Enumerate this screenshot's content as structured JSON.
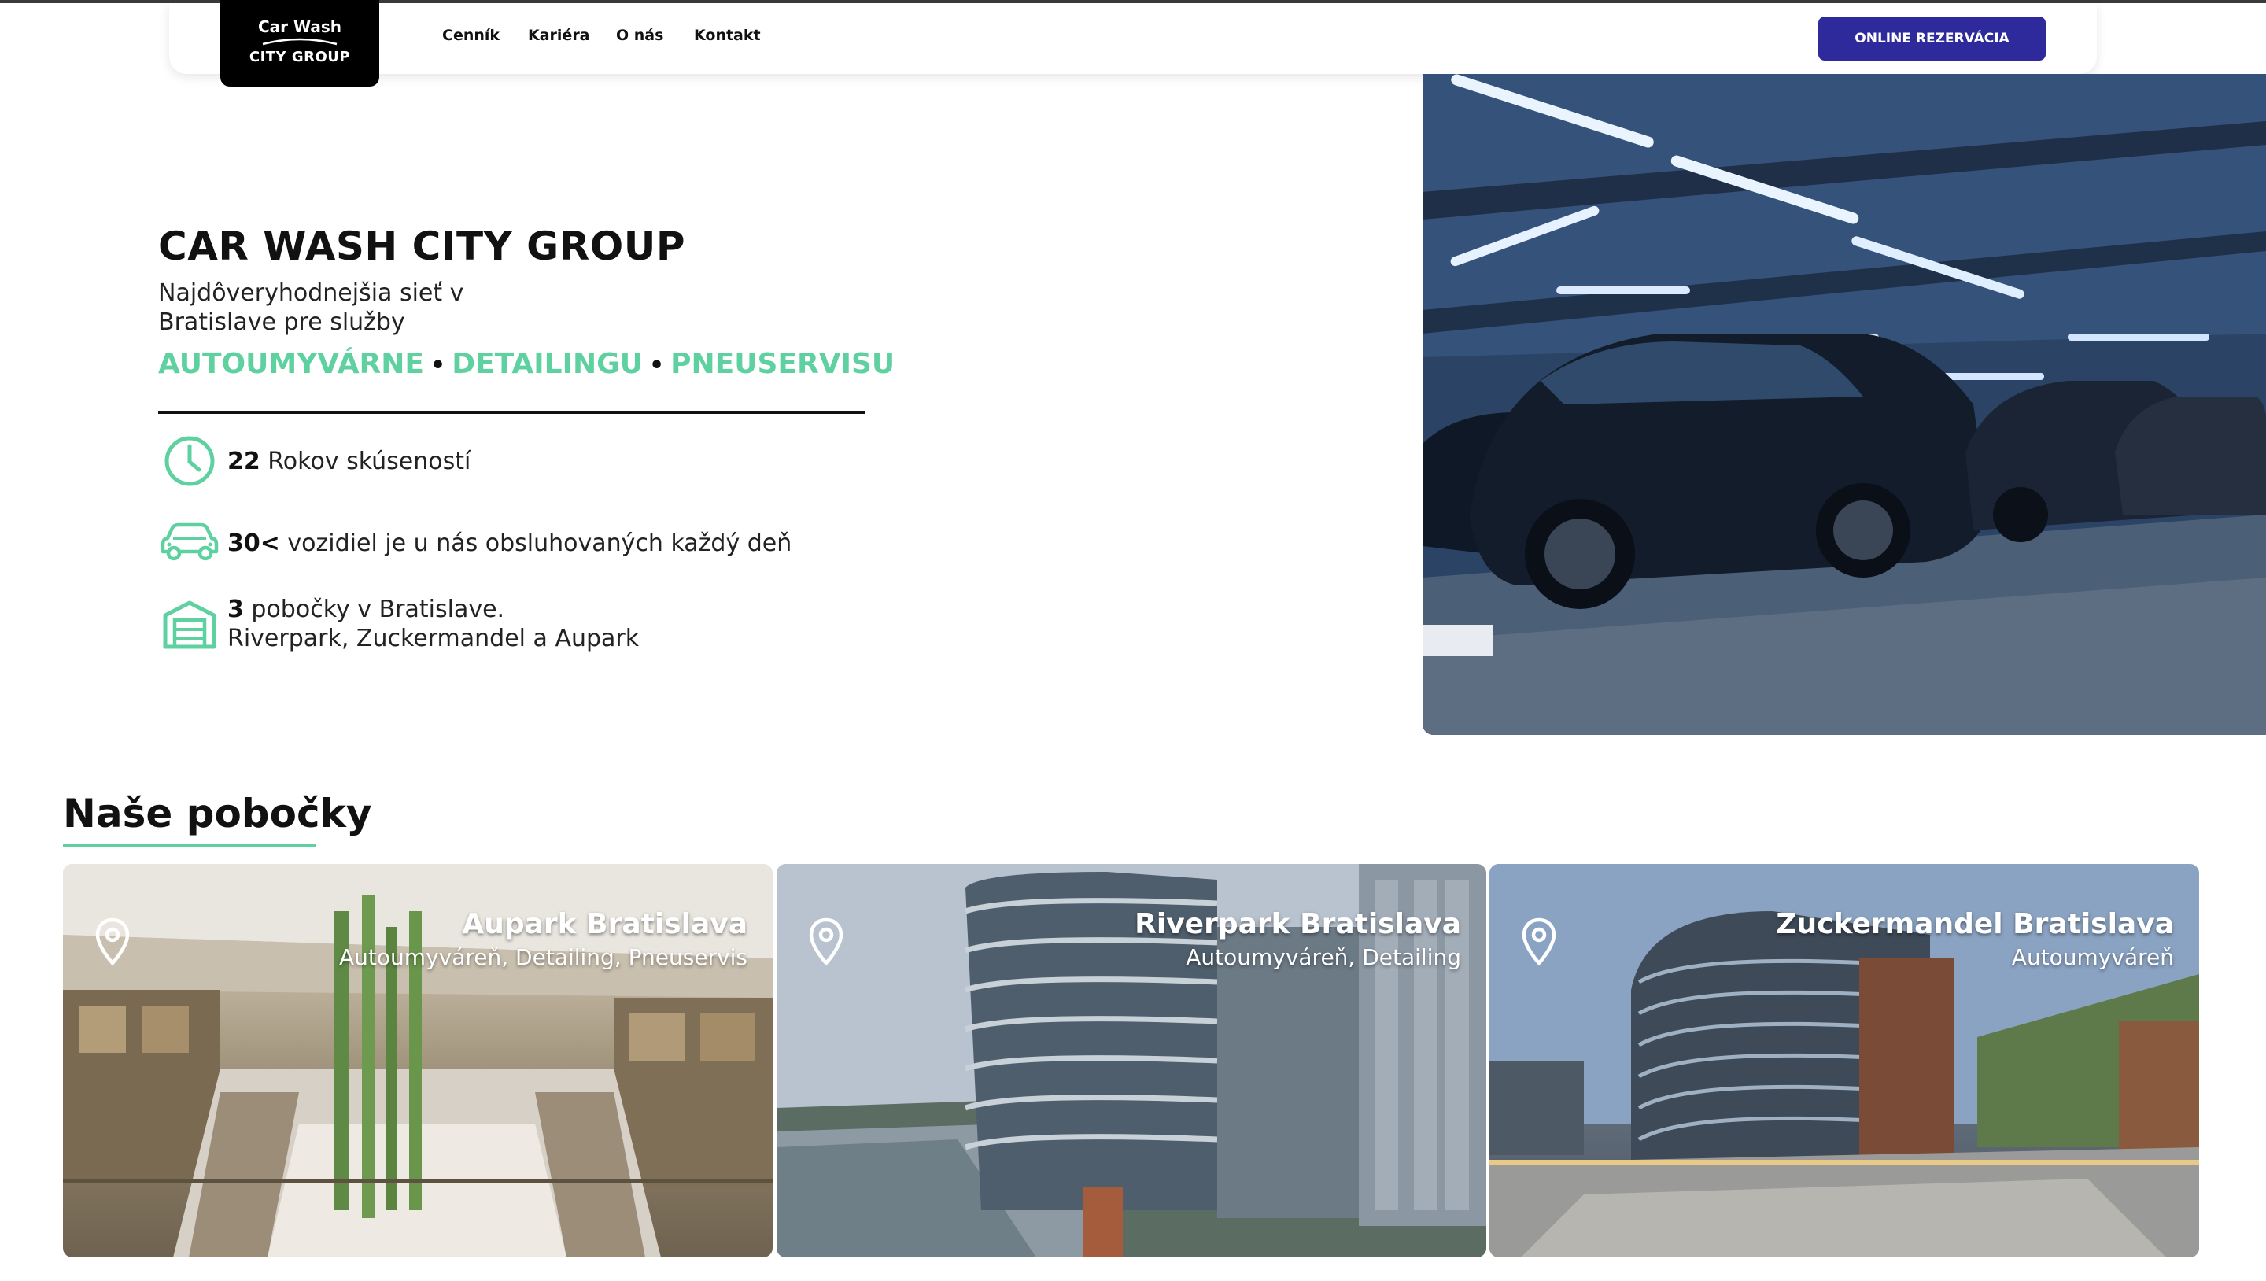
{
  "header": {
    "logo": {
      "line1": "Car Wash",
      "line2": "CITY GROUP"
    },
    "nav": [
      {
        "label": "Cenník"
      },
      {
        "label": "Kariéra"
      },
      {
        "label": "O nás"
      },
      {
        "label": "Kontakt"
      }
    ],
    "cta_label": "ONLINE REZERVÁCIA"
  },
  "hero": {
    "title": "CAR WASH CITY GROUP",
    "subtitle": "Najdôveryhodnejšia sieť v Bratislave pre služby",
    "services": [
      "AUTOUMYVÁRNE",
      "DETAILINGU",
      "PNEUSERVISU"
    ],
    "separator": "•",
    "stats": [
      {
        "icon": "clock-icon",
        "value": "22",
        "text": " Rokov skúseností"
      },
      {
        "icon": "car-icon",
        "value": "30<",
        "text": " vozidiel je u nás obsluhovaných každý deň"
      },
      {
        "icon": "garage-icon",
        "value": "3",
        "text": " pobočky v Bratislave.",
        "line2": "Riverpark, Zuckermandel a Aupark"
      }
    ]
  },
  "branches": {
    "title": "Naše pobočky",
    "items": [
      {
        "name": "Aupark Bratislava",
        "services": "Autoumyváreň, Detailing, Pneuservis"
      },
      {
        "name": "Riverpark Bratislava",
        "services": "Autoumyváreň, Detailing"
      },
      {
        "name": "Zuckermandel Bratislava",
        "services": "Autoumyváreň"
      }
    ]
  },
  "colors": {
    "accent_green": "#5fd1a0",
    "cta_blue": "#2e2a9c",
    "text_dark": "#111111"
  }
}
